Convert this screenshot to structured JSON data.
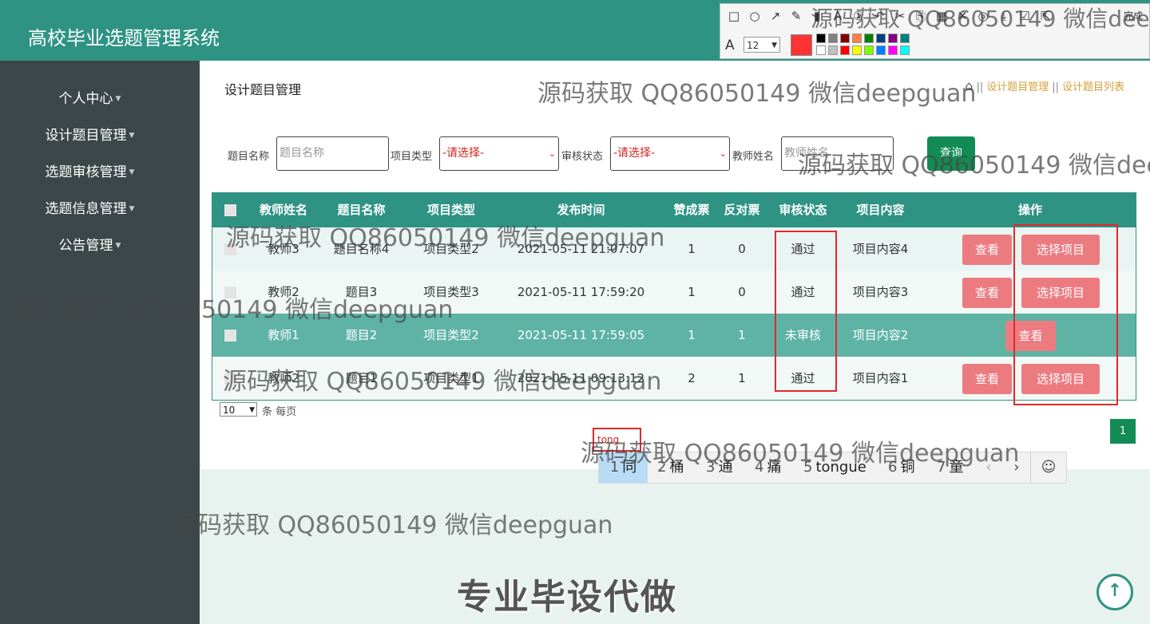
{
  "header": {
    "title": "高校毕业选题管理系统"
  },
  "sidebar": {
    "items": [
      {
        "label": "个人中心"
      },
      {
        "label": "设计题目管理"
      },
      {
        "label": "选题审核管理"
      },
      {
        "label": "选题信息管理"
      },
      {
        "label": "公告管理"
      }
    ]
  },
  "page": {
    "heading": "设计题目管理",
    "breadcrumb": [
      "设计题目管理",
      "设计题目列表"
    ]
  },
  "filters": {
    "topic_label": "题目名称",
    "topic_placeholder": "题目名称",
    "type_label": "项目类型",
    "type_value": "-请选择-",
    "status_label": "审核状态",
    "status_value": "-请选择-",
    "teacher_label": "教师姓名",
    "teacher_placeholder": "教师姓名",
    "query_label": "查询"
  },
  "table": {
    "headers": [
      "教师姓名",
      "题目名称",
      "项目类型",
      "发布时间",
      "赞成票",
      "反对票",
      "审核状态",
      "项目内容",
      "操作"
    ],
    "rows": [
      {
        "teacher": "教师3",
        "title": "题目名称4",
        "type": "项目类型2",
        "time": "2021-05-11 21:07:07",
        "yes": "1",
        "no": "0",
        "status": "通过",
        "content": "项目内容4"
      },
      {
        "teacher": "教师2",
        "title": "题目3",
        "type": "项目类型3",
        "time": "2021-05-11 17:59:20",
        "yes": "1",
        "no": "0",
        "status": "通过",
        "content": "项目内容3"
      },
      {
        "teacher": "教师1",
        "title": "题目2",
        "type": "项目类型2",
        "time": "2021-05-11 17:59:05",
        "yes": "1",
        "no": "1",
        "status": "未审核",
        "content": "项目内容2"
      },
      {
        "teacher": "教师2",
        "title": "题目1",
        "type": "项目类型1",
        "time": "2021-05-11 09:13:12",
        "yes": "2",
        "no": "1",
        "status": "通过",
        "content": "项目内容1"
      }
    ],
    "view_label": "查看",
    "select_label": "选择项目"
  },
  "pagination": {
    "page_size": "10",
    "page_size_label": "条 每页",
    "current_page": "1"
  },
  "ime": {
    "input": "tong",
    "candidates": [
      {
        "n": "1",
        "text": "同"
      },
      {
        "n": "2",
        "text": "桶"
      },
      {
        "n": "3",
        "text": "通"
      },
      {
        "n": "4",
        "text": "痛"
      },
      {
        "n": "5",
        "text": "tongue"
      },
      {
        "n": "6",
        "text": "铜"
      },
      {
        "n": "7",
        "text": "童"
      }
    ],
    "prev": "‹",
    "next": "›",
    "emoji": "☺"
  },
  "annotation_toolbar": {
    "font_size": "12",
    "done_label": "完成",
    "current_color": "#ff3333",
    "swatches_top": [
      "#000000",
      "#808080",
      "#800000",
      "#ff8040",
      "#008000",
      "#004080",
      "#800080",
      "#008080"
    ],
    "swatches_bottom": [
      "#ffffff",
      "#c0c0c0",
      "#ff0000",
      "#ffff00",
      "#80ff00",
      "#0080ff",
      "#ff00ff",
      "#00ffff"
    ]
  },
  "watermark": {
    "text": "源码获取 QQ86050149 微信deepguan"
  },
  "promo": {
    "text": "专业毕设代做"
  },
  "colors": {
    "header": "#2e9383",
    "sidebar": "#3b4748",
    "button_red": "#ec7b80",
    "query": "#128c54"
  }
}
